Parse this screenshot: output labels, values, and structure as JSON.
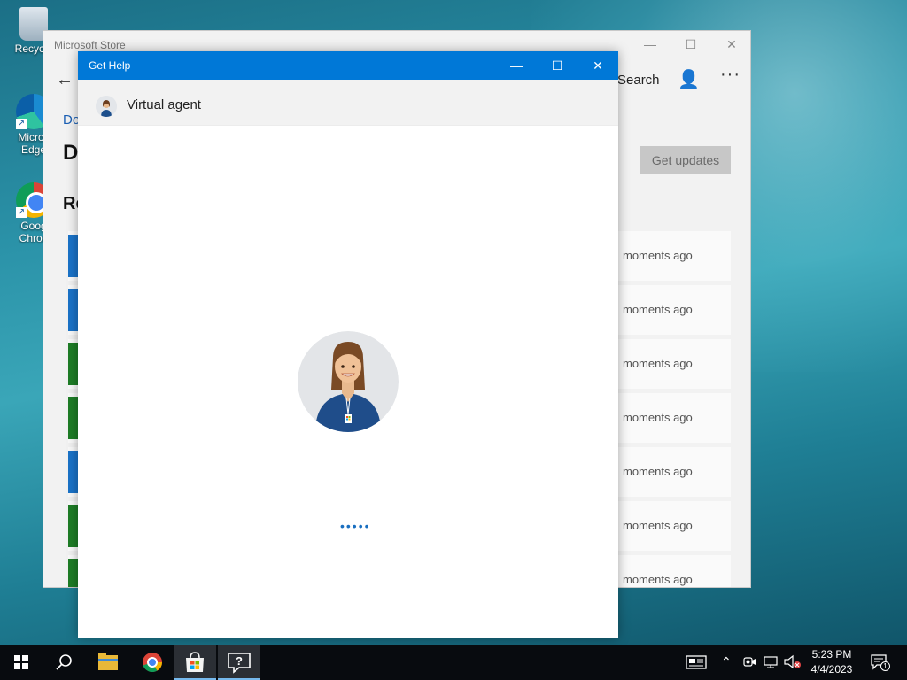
{
  "desktop": {
    "icons": [
      {
        "label": "Recycle",
        "icon": "recycle-bin-icon"
      },
      {
        "label": "Micros Edge",
        "icon": "edge-icon"
      },
      {
        "label": "Goog Chron",
        "icon": "chrome-icon"
      }
    ]
  },
  "store": {
    "title": "Microsoft Store",
    "crumb": "Do",
    "heading_d": "D",
    "heading_r": "Re",
    "search_label": "Search",
    "get_updates": "Get updates",
    "more": "···",
    "downloads": [
      {
        "time": "moments ago",
        "color": "#1a73c8"
      },
      {
        "time": "moments ago",
        "color": "#1a73c8"
      },
      {
        "time": "moments ago",
        "color": "#1e7d26"
      },
      {
        "time": "moments ago",
        "color": "#1e7d26"
      },
      {
        "time": "moments ago",
        "color": "#1a73c8"
      },
      {
        "time": "moments ago",
        "color": "#1e7d26"
      },
      {
        "time": "moments ago",
        "color": "#1e7d26"
      }
    ]
  },
  "get_help": {
    "title": "Get Help",
    "agent_name": "Virtual agent",
    "loading": "•••••"
  },
  "taskbar": {
    "apps": [
      "start-icon",
      "search-icon",
      "file-explorer-icon",
      "chrome-icon",
      "microsoft-store-icon",
      "get-help-icon"
    ],
    "time": "5:23 PM",
    "date": "4/4/2023",
    "notification_count": "1"
  },
  "colors": {
    "accent": "#0078d7",
    "taskbar": "#080b0f"
  }
}
